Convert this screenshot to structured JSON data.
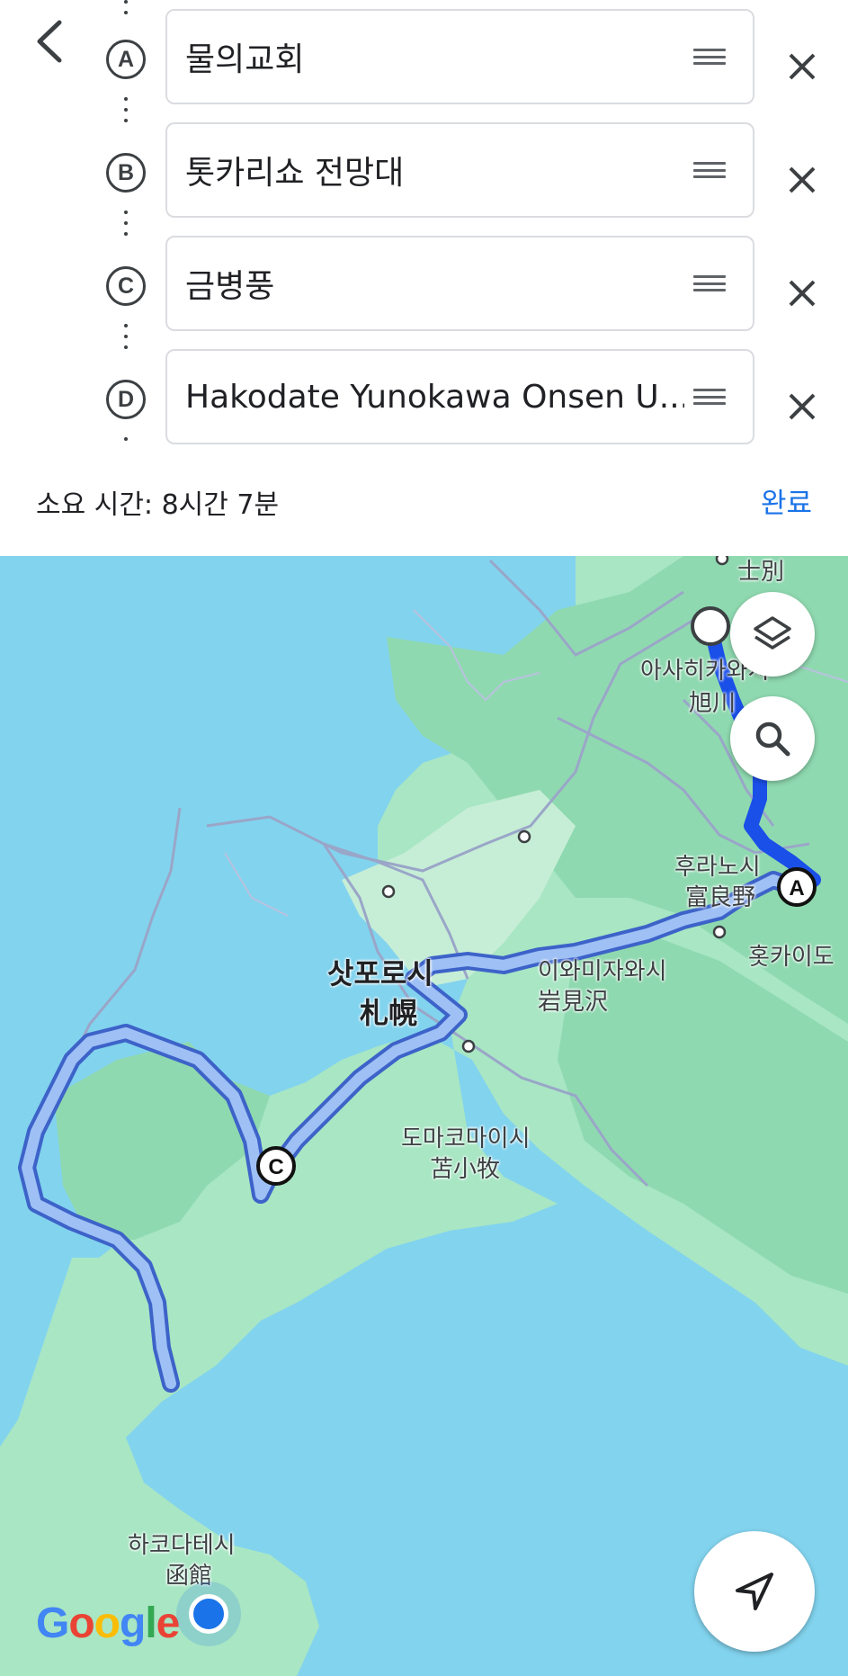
{
  "header": {
    "back_icon": "chevron-left-icon",
    "stops": [
      {
        "letter": "A",
        "name": "물의교회"
      },
      {
        "letter": "B",
        "name": "톳카리쇼 전망대"
      },
      {
        "letter": "C",
        "name": "금병풍"
      },
      {
        "letter": "D",
        "name": "Hakodate Yunokawa Onsen U..."
      }
    ],
    "duration_text": "소요 시간: 8시간 7분",
    "done_label": "완료"
  },
  "map": {
    "labels": {
      "shibetsu": "士別",
      "asahikawa_ko": "아사히카와시",
      "asahikawa_ja": "旭川",
      "furano_ko": "후라노시",
      "furano_ja": "富良野",
      "hokkaido": "홋카이도",
      "iwamizawa_ko": "이와미자와시",
      "iwamizawa_ja": "岩見沢",
      "sapporo_ko": "삿포로시",
      "sapporo_ja": "札幌",
      "tomakomai_ko": "도마코마이시",
      "tomakomai_ja": "苫小牧",
      "hakodate_ko": "하코다테시",
      "hakodate_ja": "函館"
    },
    "markers": {
      "a": "A",
      "c": "C"
    },
    "google": {
      "g1": "G",
      "o1": "o",
      "o2": "o",
      "g2": "g",
      "l": "l",
      "e": "e"
    },
    "colors": {
      "water": "#82d3ee",
      "land": "#a8e6c4",
      "forest": "#8fd9b0",
      "route_primary": "#1a4fe8",
      "route_alt": "#9ec0f5",
      "accent": "#1a73e8"
    },
    "controls": {
      "layers_icon": "layers-icon",
      "search_icon": "search-icon",
      "navigate_icon": "navigation-arrow-icon"
    }
  }
}
